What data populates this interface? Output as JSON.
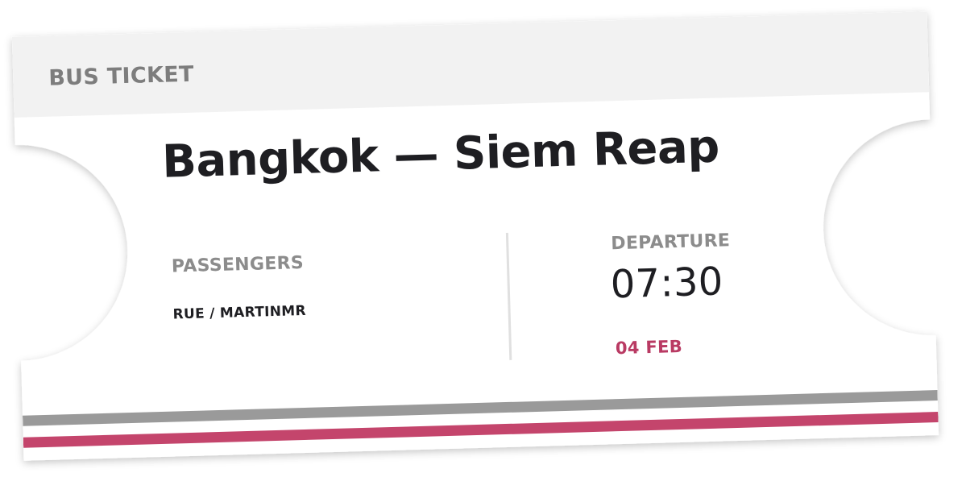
{
  "ticket": {
    "label": "BUS TICKET",
    "route": "Bangkok — Siem Reap"
  },
  "passengers": {
    "heading": "PASSENGERS",
    "names": "RUE / MARTINMR"
  },
  "departure": {
    "heading": "DEPARTURE",
    "time": "07:30",
    "date": "04 FEB"
  },
  "colors": {
    "header_band": "#f2f2f2",
    "ticket_body": "#ffffff",
    "text_dark": "#1e1e22",
    "text_muted": "#8c8c8c",
    "accent": "#b93a63",
    "stripe_gray": "#9a9a9a",
    "stripe_accent": "#c4456c"
  }
}
